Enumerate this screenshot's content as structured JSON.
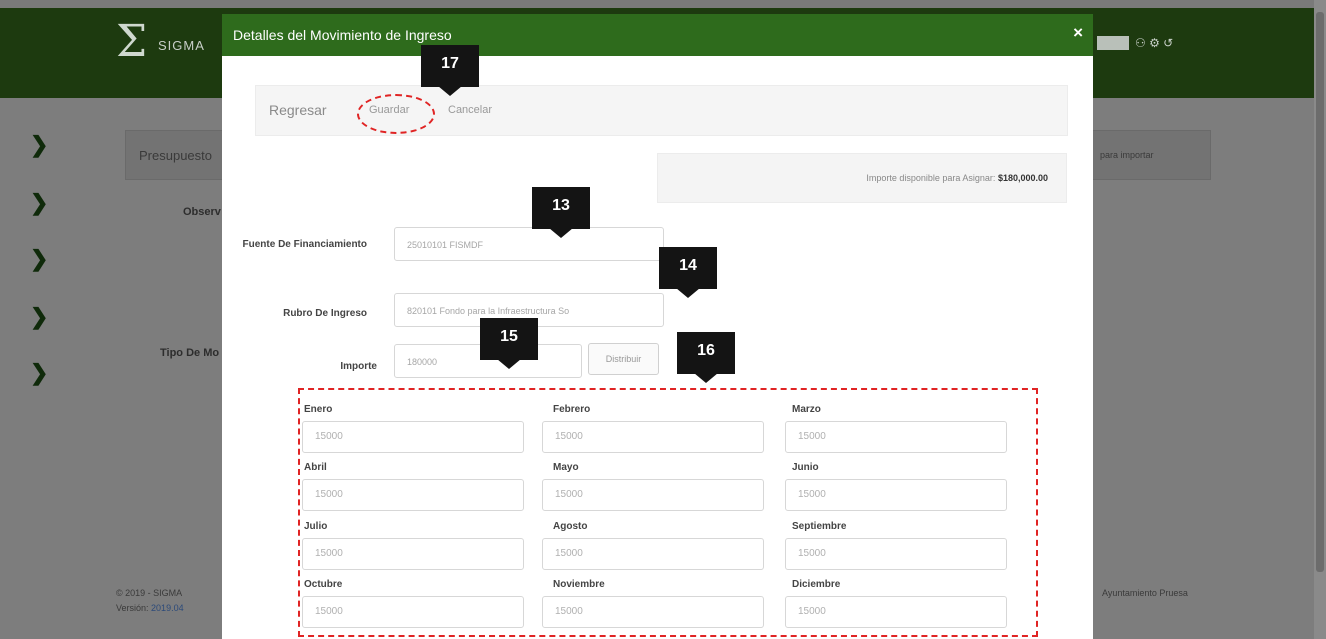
{
  "app": {
    "brand": "SIGMA",
    "topbar_right_text": "⚇ ⚙ ↺"
  },
  "background": {
    "panel_label": "Presupuesto",
    "panel_right": "para importar",
    "observ_label": "Observ",
    "tipo_label": "Tipo De Mo",
    "footer_copy": "© 2019 - SIGMA",
    "footer_version_label": "Versión:",
    "footer_version_value": "2019.04",
    "footer_right": "Ayuntamiento Pruesa"
  },
  "modal": {
    "title": "Detalles del Movimiento de Ingreso",
    "close": "×",
    "toolbar": {
      "back": "Regresar",
      "save": "Guardar",
      "cancel": "Cancelar"
    },
    "available": {
      "label": "Importe disponible para Asignar:",
      "value": "$180,000.00"
    },
    "fields": {
      "fuente_label": "Fuente De Financiamiento",
      "fuente_value": "25010101 FISMDF",
      "rubro_label": "Rubro De Ingreso",
      "rubro_value": "820101 Fondo para la Infraestructura So",
      "importe_label": "Importe",
      "importe_value": "180000",
      "distribute_button": "Distribuir"
    },
    "months": [
      {
        "label": "Enero",
        "value": "15000"
      },
      {
        "label": "Febrero",
        "value": "15000"
      },
      {
        "label": "Marzo",
        "value": "15000"
      },
      {
        "label": "Abril",
        "value": "15000"
      },
      {
        "label": "Mayo",
        "value": "15000"
      },
      {
        "label": "Junio",
        "value": "15000"
      },
      {
        "label": "Julio",
        "value": "15000"
      },
      {
        "label": "Agosto",
        "value": "15000"
      },
      {
        "label": "Septiembre",
        "value": "15000"
      },
      {
        "label": "Octubre",
        "value": "15000"
      },
      {
        "label": "Noviembre",
        "value": "15000"
      },
      {
        "label": "Diciembre",
        "value": "15000"
      }
    ]
  },
  "callouts": {
    "c13": "13",
    "c14": "14",
    "c15": "15",
    "c16": "16",
    "c17": "17"
  },
  "colors": {
    "header_green": "#2e6b1c",
    "annotation_red": "#e02424"
  }
}
